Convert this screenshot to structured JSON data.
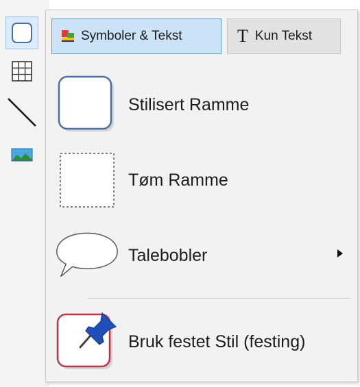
{
  "toolbar": {
    "items": [
      {
        "icon": "rounded-rect-icon"
      },
      {
        "icon": "grid-icon"
      },
      {
        "icon": "line-icon"
      },
      {
        "icon": "image-icon"
      }
    ]
  },
  "menu": {
    "tabs": [
      {
        "label": "Symboler & Tekst",
        "icon": "symbols-icon"
      },
      {
        "label": "Kun Tekst",
        "icon": "text-t-icon"
      }
    ],
    "items": [
      {
        "label": "Stilisert Ramme",
        "icon": "styled-frame-icon"
      },
      {
        "label": "Tøm Ramme",
        "icon": "empty-frame-icon"
      },
      {
        "label": "Talebobler",
        "icon": "speech-bubble-icon",
        "submenu": true
      },
      {
        "label": "Bruk festet Stil (festing)",
        "icon": "pinned-style-icon"
      }
    ]
  },
  "colors": {
    "selected_tab_bg": "#cce2f7",
    "selected_tab_border": "#5a9ad8",
    "frame_border": "#4a6fa5",
    "pinned_border": "#c0324a",
    "pin_blue": "#1f4fb8"
  }
}
